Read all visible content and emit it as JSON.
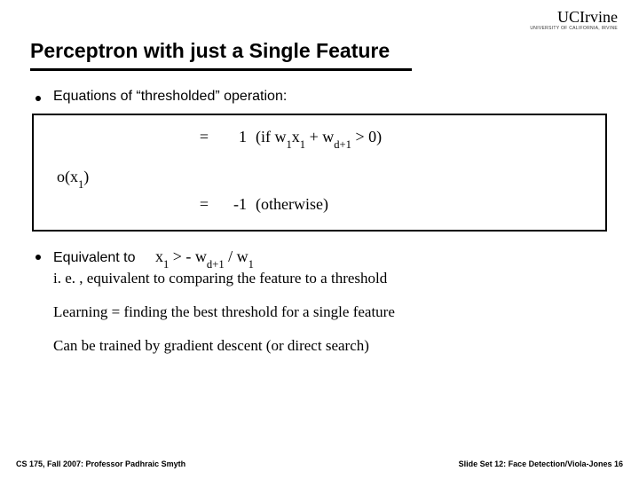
{
  "logo": {
    "main": "UCIrvine",
    "sub": "UNIVERSITY OF CALIFORNIA, IRVINE"
  },
  "title": "Perceptron with just a Single Feature",
  "bullet1": "Equations of “thresholded” operation:",
  "eq": {
    "fn": "o(x",
    "fn_sub": "1",
    "fn_close": ")",
    "eq_sign": "=",
    "r1_val": "1",
    "r1_cond_prefix": "(if   w",
    "r1_cond_s1": "1",
    "r1_cond_mid1": "x",
    "r1_cond_s2": "1",
    "r1_cond_mid2": " + ",
    "r1_cond_w2": "w",
    "r1_cond_s3": "d+1",
    "r1_cond_suffix": " > 0)",
    "r2_val": "-1",
    "r2_cond": "(otherwise)"
  },
  "bullet2_label": "Equivalent to",
  "ineq": {
    "p1": "x",
    "s1": "1",
    "p2": " > - ",
    "w2": "w",
    "s2": "d+1",
    "p3": " / w",
    "s3": "1"
  },
  "line_ie": "i. e. , equivalent to comparing the feature to a threshold",
  "line_learn": "Learning = finding the best threshold for a single feature",
  "line_train": "Can be trained by gradient descent (or direct search)",
  "footer": {
    "left": "CS 175, Fall 2007: Professor Padhraic Smyth",
    "right": "Slide Set 12: Face Detection/Viola-Jones 16"
  }
}
